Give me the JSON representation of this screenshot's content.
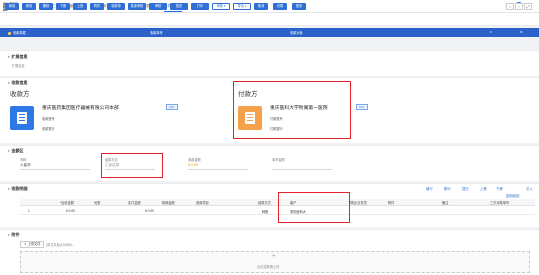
{
  "app": {
    "logo_line1": "用友网络科技",
    "logo_line2": "BIP",
    "selector": "出纳",
    "close_all": "×"
  },
  "nav_tabs": [
    "三方收款明细列表",
    "三方收款列表",
    "收款处理列表",
    "合同收款单"
  ],
  "toolbar": {
    "buttons": [
      "新增",
      "修改",
      "删除",
      "下推",
      "上查",
      "附件",
      "收款单",
      "批量审核",
      "审核",
      "推送",
      "打印",
      "取消",
      "关联",
      "更多"
    ],
    "menu_buttons": [
      "审核",
      "导出"
    ],
    "more_label": "更多"
  },
  "strip": {
    "left": "收款单据",
    "mid1": "收款单号",
    "mid2": "收款对象"
  },
  "extend": {
    "title": "扩展信息",
    "sub": "扩展信息"
  },
  "collect": {
    "title": "收款信息",
    "payee": {
      "label": "收款方",
      "name": "重庆医药集团医疗器械有限公司本部",
      "tag": "CNY",
      "acct_label": "收款账号",
      "bank_label": "收款银行"
    },
    "payer": {
      "label": "付款方",
      "name": "重庆医科大学附属第一医院",
      "tag": "CNY",
      "acct_label": "付款账号",
      "bank_label": "付款银行"
    }
  },
  "amount": {
    "title": "金额区",
    "currency_label": "币种",
    "currency_value": "人民币",
    "method_label": "结算方式",
    "method_value": "汇款结算",
    "amount_label": "收款金额",
    "amount_value": "¥ 0.00",
    "rate_label": "本币金额"
  },
  "detail": {
    "title": "收款明细",
    "actions": [
      "增行",
      "删行",
      "插行",
      "上移",
      "下移",
      "复制粘贴",
      "引入"
    ],
    "columns": [
      "*应收金额",
      "优惠",
      "实付金额",
      "核销金额",
      "费用项目",
      "结算方式",
      "客户",
      "项目/业务员",
      "附件",
      "备注",
      "三方对账单号"
    ],
    "row": {
      "index": "1",
      "amount": "¥ 0.00",
      "paid": "¥ 0.00",
      "settle": "转账",
      "customer": "重庆医科大"
    }
  },
  "attach": {
    "title": "附件",
    "upload": "上传文件",
    "hint": "(单文件最大50MB)",
    "drop": "点击或拖拽上传"
  }
}
